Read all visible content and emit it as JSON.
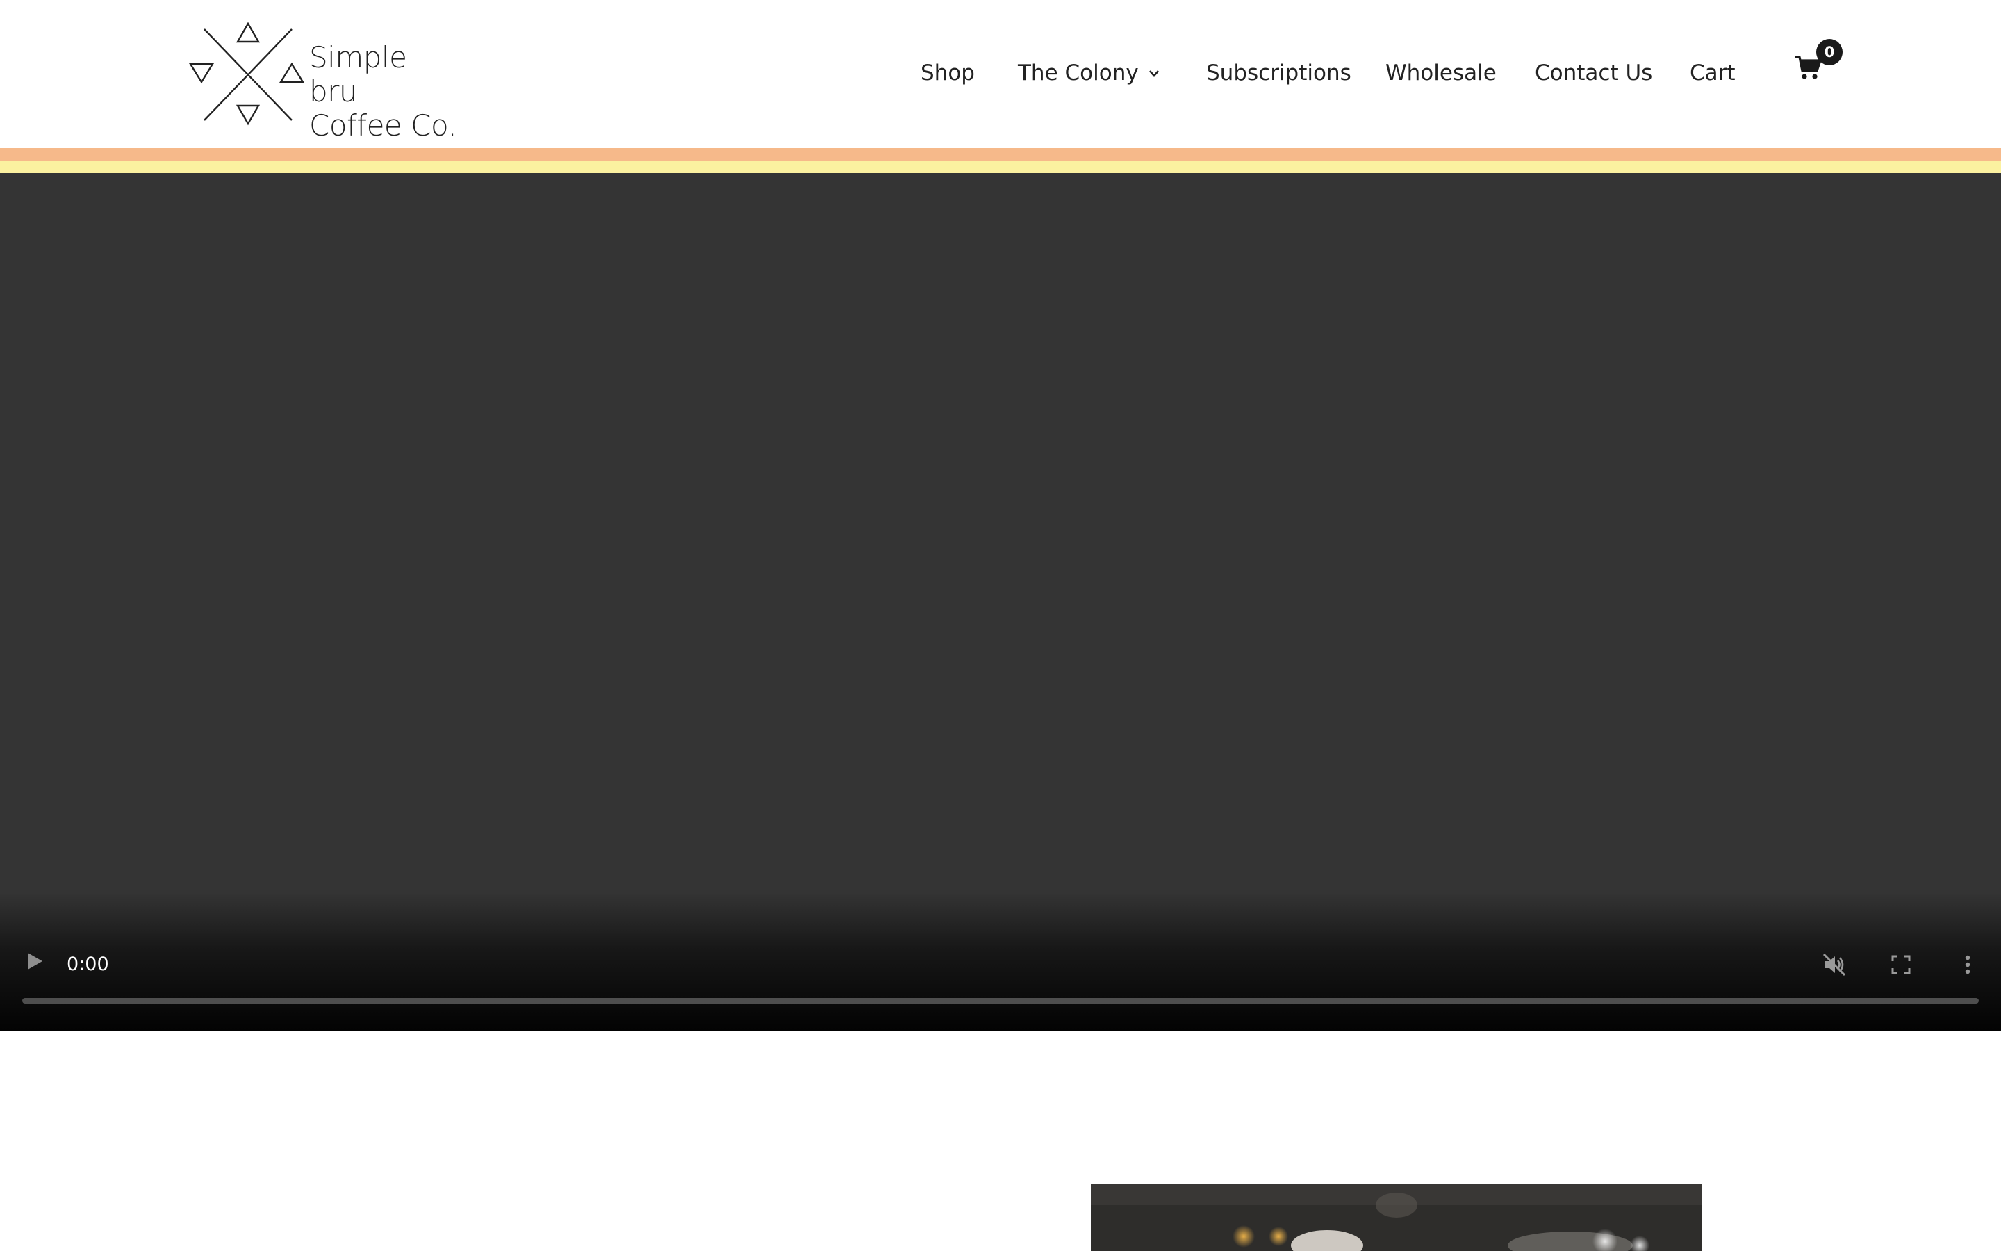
{
  "brand": {
    "name_line1": "Simple bru",
    "name_line2": "Coffee Co.",
    "logo_icon": "crossed-triangles-logo"
  },
  "nav": {
    "items": [
      {
        "label": "Shop"
      },
      {
        "label": "The Colony",
        "has_dropdown": true
      },
      {
        "label": "Subscriptions"
      },
      {
        "label": "Wholesale"
      },
      {
        "label": "Contact Us"
      },
      {
        "label": "Cart"
      }
    ],
    "cart_icon": "shopping-cart-icon",
    "cart_count": "0"
  },
  "colors": {
    "stripe_top": "#f6b98a",
    "stripe_bottom": "#fbf1a0",
    "video_bg": "#343434"
  },
  "video": {
    "time": "0:00",
    "progress": 0,
    "muted": true,
    "controls": [
      "play-icon",
      "muted-icon",
      "fullscreen-icon",
      "more-vert-icon"
    ]
  }
}
